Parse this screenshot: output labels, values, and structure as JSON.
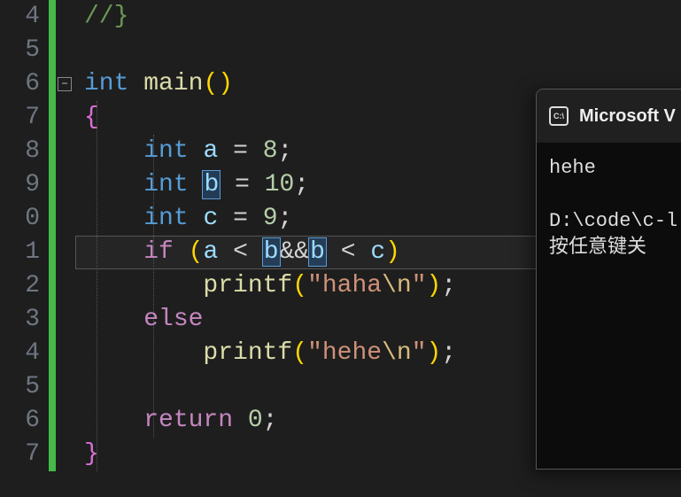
{
  "gutter": {
    "lines": [
      "4",
      "5",
      "6",
      "7",
      "8",
      "9",
      "0",
      "1",
      "2",
      "3",
      "4",
      "5",
      "6",
      "7"
    ]
  },
  "code": {
    "l4_comment": "//}",
    "l6_type": "int",
    "l6_func": "main",
    "l6_paren_open": "(",
    "l6_paren_close": ")",
    "l7_brace": "{",
    "l8_type": "int",
    "l8_var": "a",
    "l8_eq": " = ",
    "l8_num": "8",
    "l8_sc": ";",
    "l9_type": "int",
    "l9_var": "b",
    "l9_eq": " = ",
    "l9_num": "10",
    "l9_sc": ";",
    "l10_type": "int",
    "l10_var": "c",
    "l10_eq": " = ",
    "l10_num": "9",
    "l10_sc": ";",
    "l11_kw": "if",
    "l11_po": "(",
    "l11_a": "a",
    "l11_lt1": " < ",
    "l11_b1": "b",
    "l11_and": "&&",
    "l11_b2": "b",
    "l11_lt2": " < ",
    "l11_c": "c",
    "l11_pc": ")",
    "l12_func": "printf",
    "l12_po": "(",
    "l12_q1": "\"",
    "l12_str": "haha",
    "l12_esc": "\\n",
    "l12_q2": "\"",
    "l12_pc": ")",
    "l12_sc": ";",
    "l13_kw": "else",
    "l14_func": "printf",
    "l14_po": "(",
    "l14_q1": "\"",
    "l14_str": "hehe",
    "l14_esc": "\\n",
    "l14_q2": "\"",
    "l14_pc": ")",
    "l14_sc": ";",
    "l16_kw": "return",
    "l16_num": "0",
    "l16_sc": ";",
    "l17_brace": "}"
  },
  "fold_icon": "−",
  "console": {
    "icon_text": "C:\\",
    "title": "Microsoft V",
    "out1": "hehe",
    "out2": "D:\\code\\c-l",
    "out3": "按任意键关"
  }
}
